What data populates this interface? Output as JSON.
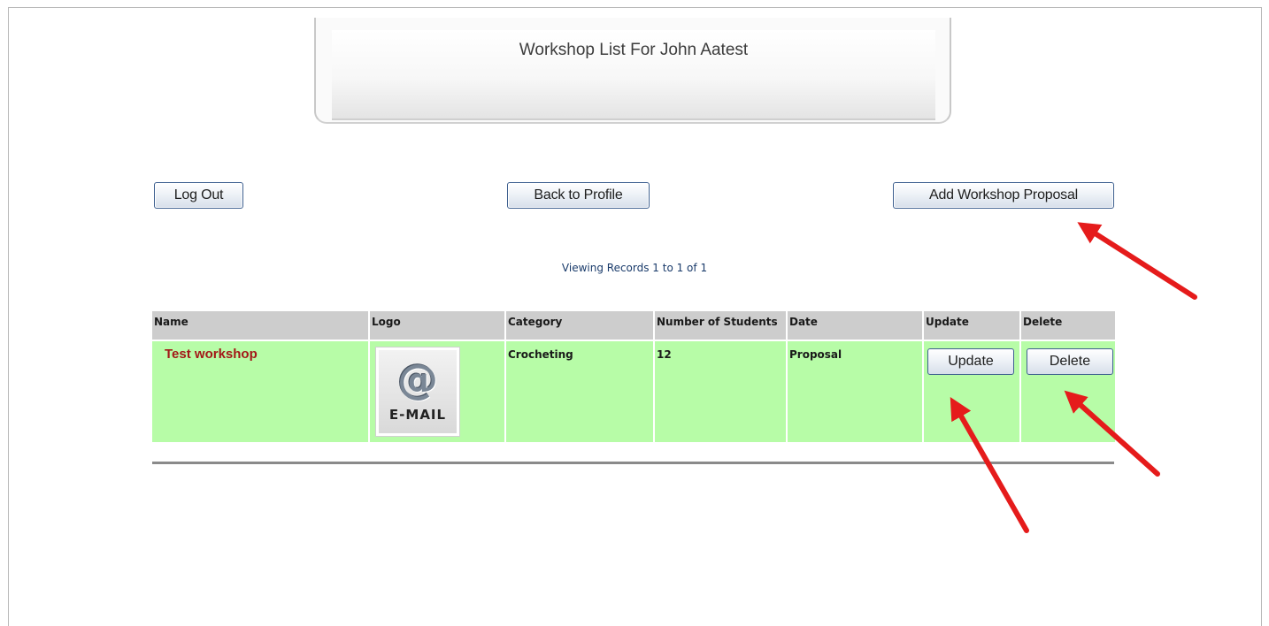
{
  "header": {
    "title": "Workshop List For John Aatest"
  },
  "toolbar": {
    "logout_label": "Log Out",
    "back_label": "Back to Profile",
    "add_label": "Add Workshop Proposal"
  },
  "records": {
    "viewing_text": "Viewing Records 1 to 1 of 1"
  },
  "table": {
    "columns": [
      "Name",
      "Logo",
      "Category",
      "Number of Students",
      "Date",
      "Update",
      "Delete"
    ],
    "rows": [
      {
        "name": "Test workshop",
        "logo_icon": "email-at-icon",
        "logo_text": "E-MAIL",
        "logo_symbol": "@",
        "category": "Crocheting",
        "students": "12",
        "date": "Proposal",
        "update_label": "Update",
        "delete_label": "Delete"
      }
    ]
  },
  "colors": {
    "row_bg": "#b7fca7",
    "header_bg": "#cdcdcd",
    "name_color": "#a31818",
    "arrow_color": "#e51b1b"
  }
}
